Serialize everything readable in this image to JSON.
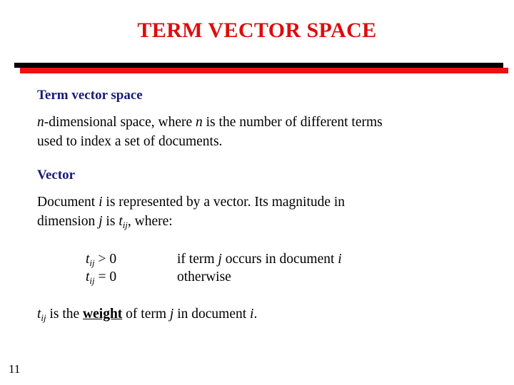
{
  "slide": {
    "title": "TERM VECTOR SPACE",
    "page_number": "11",
    "colors": {
      "title_red": "#dd0d0d",
      "divider_red": "#ee1111",
      "divider_black": "#000000",
      "heading_navy": "#1a1a78",
      "body_black": "#000000",
      "background": "#ffffff"
    }
  },
  "content": {
    "section1": {
      "heading": "Term vector space",
      "body_line1_prefix": "n",
      "body_line1_mid": "-dimensional space, where ",
      "body_line1_var": "n",
      "body_line1_suffix": " is the number of different terms",
      "body_line2": "used to index a set of documents."
    },
    "section2": {
      "heading": "Vector",
      "body_line1_a": "Document ",
      "body_line1_var": "i",
      "body_line1_b": " is represented by a vector.  Its magnitude in",
      "body_line2_a": "dimension ",
      "body_line2_var_j": "j",
      "body_line2_b": " is ",
      "body_line2_var_t": "t",
      "body_line2_sub": "ij",
      "body_line2_c": ", where:"
    },
    "formulas": [
      {
        "lhs_symbol": "t",
        "lhs_sub": "ij",
        "lhs_operator": " > 0",
        "rhs_a": "if term ",
        "rhs_var_j": "j",
        "rhs_b": " occurs in document ",
        "rhs_var_i": "i",
        "rhs_c": ""
      },
      {
        "lhs_symbol": "t",
        "lhs_sub": "ij",
        "lhs_operator": " = 0",
        "rhs_a": "otherwise",
        "rhs_var_j": "",
        "rhs_b": "",
        "rhs_var_i": "",
        "rhs_c": ""
      }
    ],
    "closing": {
      "var_t": "t",
      "sub": "ij",
      "text_a": " is the ",
      "emphasis": "weight",
      "text_b": " of term ",
      "var_j": "j",
      "text_c": " in document ",
      "var_i": "i",
      "text_d": "."
    }
  }
}
